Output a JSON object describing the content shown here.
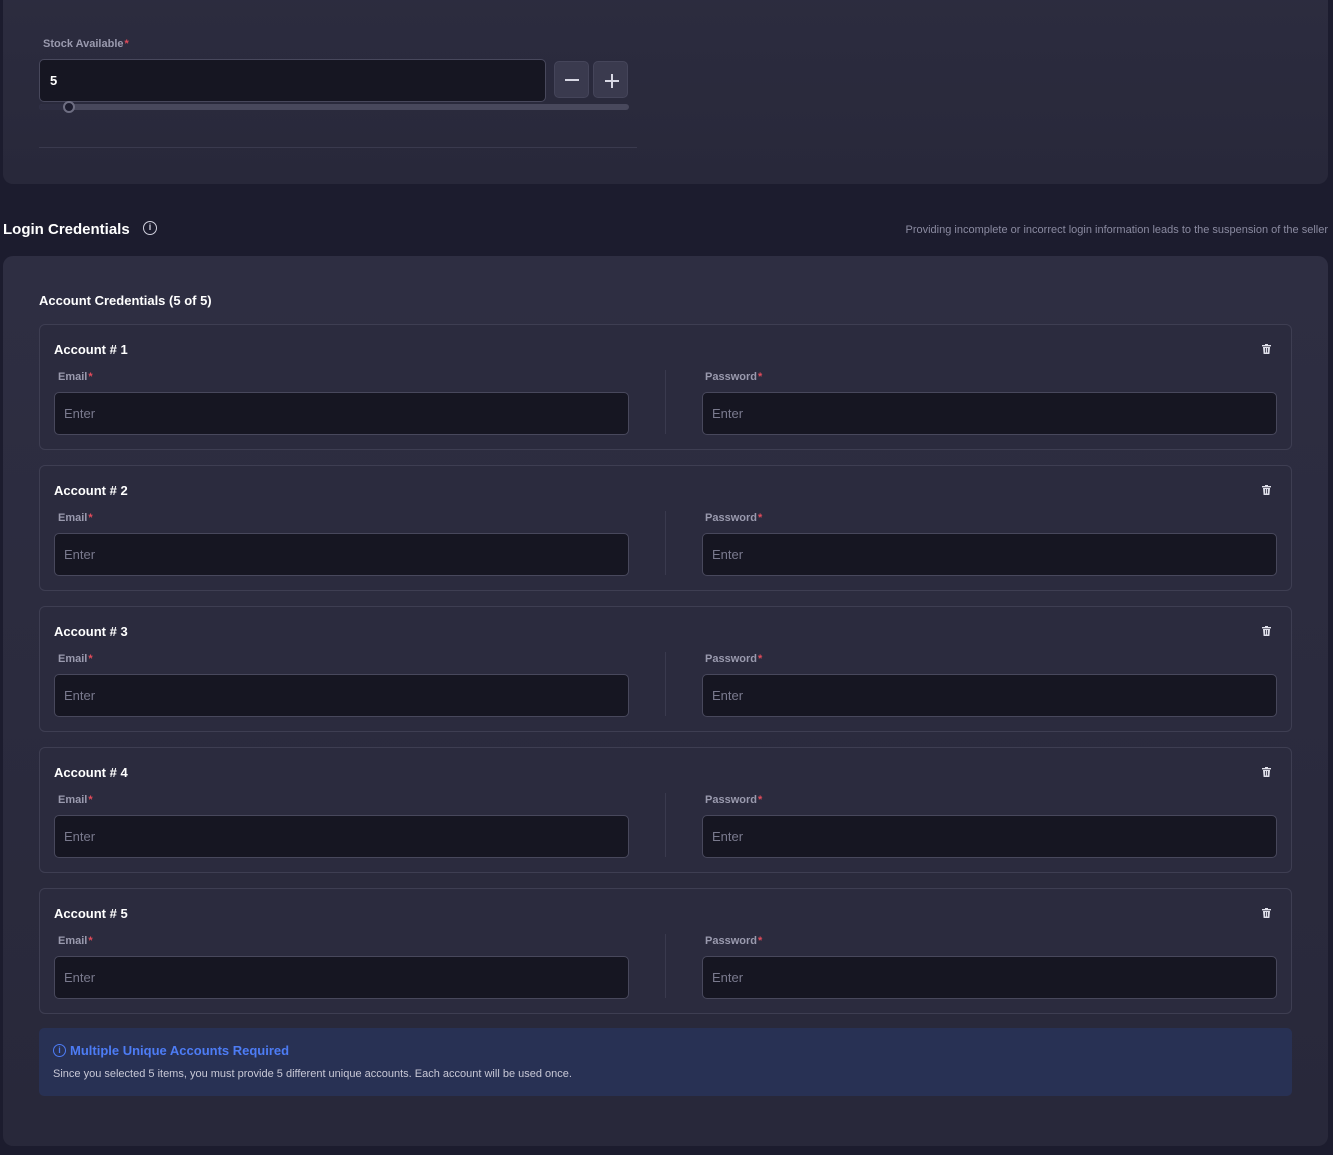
{
  "stock": {
    "label": "Stock Available",
    "required_mark": "*",
    "value": "5",
    "slider_fraction": 0.05
  },
  "login_credentials": {
    "title": "Login Credentials",
    "note": "Providing incomplete or incorrect login information leads to the suspension of the seller",
    "heading": "Account Credentials (5 of 5)",
    "accounts": [
      {
        "title": "Account # 1",
        "email_label": "Email",
        "password_label": "Password",
        "email_placeholder": "Enter",
        "password_placeholder": "Enter"
      },
      {
        "title": "Account # 2",
        "email_label": "Email",
        "password_label": "Password",
        "email_placeholder": "Enter",
        "password_placeholder": "Enter"
      },
      {
        "title": "Account # 3",
        "email_label": "Email",
        "password_label": "Password",
        "email_placeholder": "Enter",
        "password_placeholder": "Enter"
      },
      {
        "title": "Account # 4",
        "email_label": "Email",
        "password_label": "Password",
        "email_placeholder": "Enter",
        "password_placeholder": "Enter"
      },
      {
        "title": "Account # 5",
        "email_label": "Email",
        "password_label": "Password",
        "email_placeholder": "Enter",
        "password_placeholder": "Enter"
      }
    ],
    "notice": {
      "title": "Multiple Unique Accounts Required",
      "text": "Since you selected 5 items, you must provide 5 different unique accounts. Each account will be used once."
    }
  },
  "colors": {
    "background": "#1c1c2e",
    "card": "#2a2a3c",
    "input_bg": "#161622",
    "required": "#e14b5a",
    "notice_bg": "#283154",
    "notice_accent": "#4d7cf5"
  },
  "icons": {
    "title_info": "info-icon",
    "notice_info": "info-icon",
    "delete": "trash-icon",
    "decrement": "minus-icon",
    "increment": "plus-icon"
  }
}
